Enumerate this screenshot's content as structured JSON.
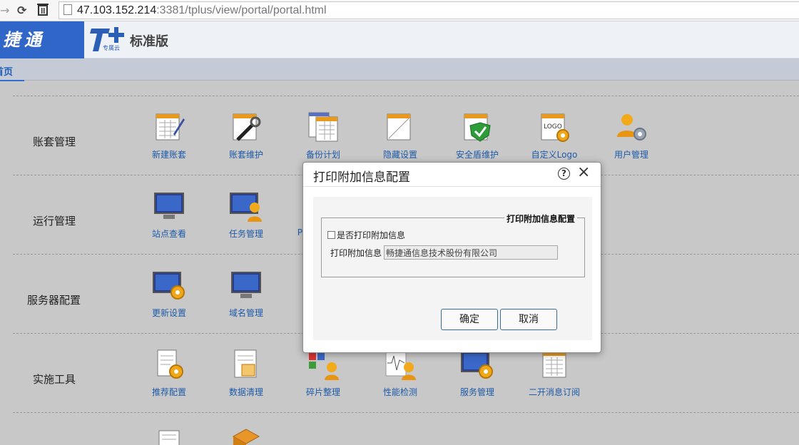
{
  "browser": {
    "url_host": "47.103.152.214",
    "url_rest": ":3381/tplus/view/portal/portal.html"
  },
  "header": {
    "brand": "捷通",
    "logo_sub": "专属云",
    "logo_text": "标准版"
  },
  "tabs": {
    "home": "首页"
  },
  "sections": {
    "account": {
      "label": "账套管理",
      "items": [
        "新建账套",
        "账套维护",
        "备份计划",
        "隐藏设置",
        "安全盾维护",
        "自定义Logo",
        "用户管理"
      ]
    },
    "runtime": {
      "label": "运行管理",
      "items": [
        "站点查看",
        "任务管理",
        "P"
      ]
    },
    "server": {
      "label": "服务器配置",
      "items": [
        "更新设置",
        "域名管理"
      ]
    },
    "tools": {
      "label": "实施工具",
      "items": [
        "推荐配置",
        "数据清理",
        "碎片整理",
        "性能检测",
        "服务管理",
        "二开消息订阅"
      ]
    }
  },
  "modal": {
    "title": "打印附加信息配置",
    "help": "?",
    "close": "×",
    "legend": "打印附加信息配置",
    "checkbox_label": "是否打印附加信息",
    "field_label": "打印附加信息",
    "field_value": "畅捷通信息技术股份有限公司",
    "ok": "确定",
    "cancel": "取消"
  },
  "colors": {
    "brand_blue": "#2f66c7",
    "link_blue": "#1d5aa8",
    "button_border": "#3a6a98"
  }
}
